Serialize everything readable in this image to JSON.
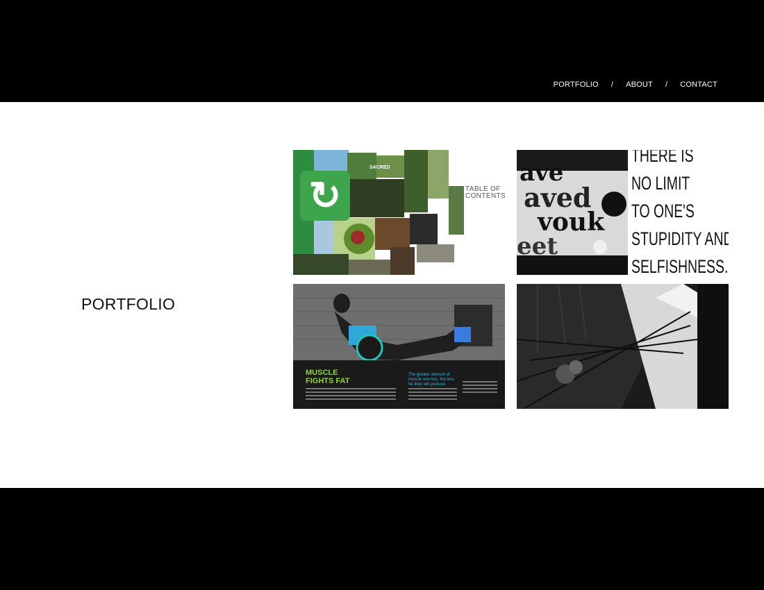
{
  "nav": {
    "items": [
      {
        "label": "PORTFOLIO"
      },
      {
        "label": "ABOUT"
      },
      {
        "label": "CONTACT"
      }
    ],
    "separator": "/"
  },
  "page": {
    "title": "PORTFOLIO"
  },
  "tiles": [
    {
      "name": "collage-magazine-spread",
      "toc_title": "TABLE OF CONTENTS",
      "caption": "SACRED"
    },
    {
      "name": "typographic-quote",
      "quote_lines": [
        "THERE IS",
        "NO LIMIT",
        "TO ONE'S",
        "STUPIDITY AND",
        "SELFISHNESS."
      ]
    },
    {
      "name": "fitness-magazine-spread",
      "headline_1": "MUSCLE",
      "headline_2": "FIGHTS FAT",
      "subhead": "The greater amount of muscle one has, the less fat they will produce."
    },
    {
      "name": "architecture-photo"
    }
  ],
  "colors": {
    "header_bg": "#000000",
    "main_bg": "#ffffff",
    "accent_green": "#8fd43a",
    "accent_blue": "#3ab0d8"
  }
}
